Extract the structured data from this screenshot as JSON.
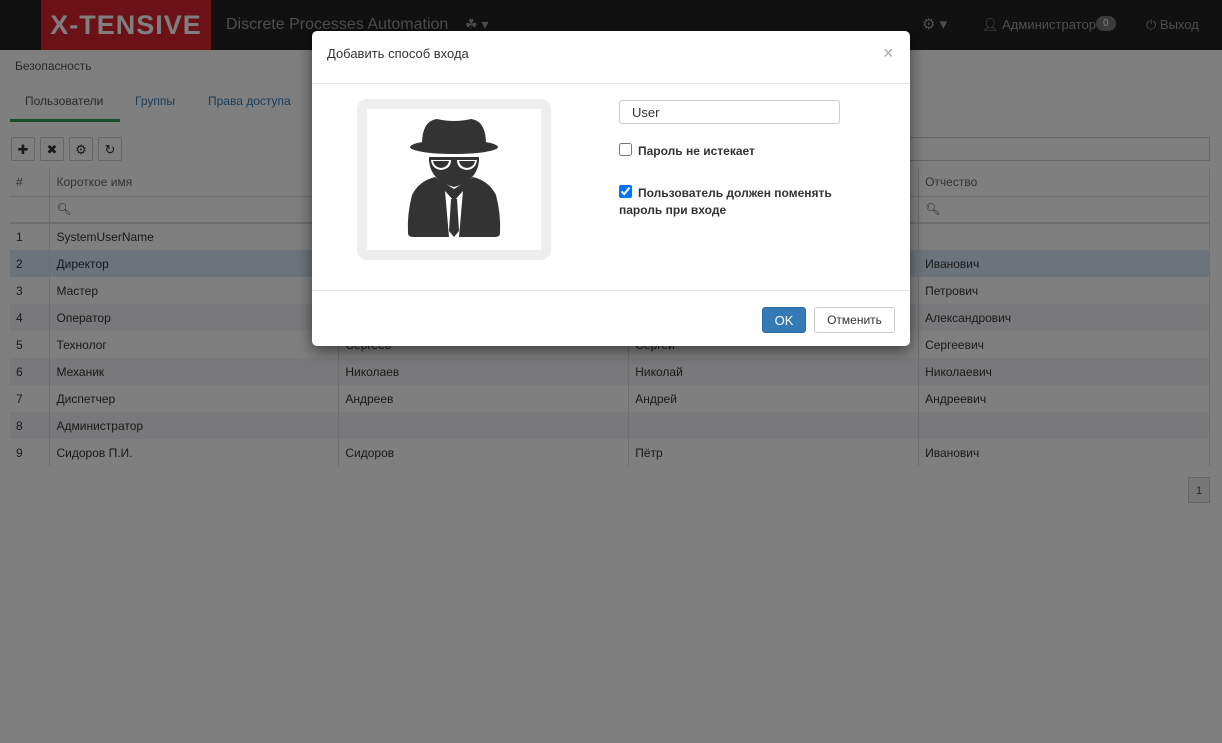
{
  "navbar": {
    "brand": "X-TENSIVE",
    "app_title": "Discrete Processes Automation",
    "apps_menu": "☘ ▾",
    "settings_menu": "⚙ ▾",
    "user_name": "Администратор",
    "notifications_count": "0",
    "logout_label": "Выход"
  },
  "breadcrumb": "Безопасность",
  "tabs": [
    {
      "label": "Пользователи",
      "active": true
    },
    {
      "label": "Группы",
      "active": false
    },
    {
      "label": "Права доступа",
      "active": false
    }
  ],
  "toolbar": {
    "add": "✚",
    "delete": "✖",
    "settings": "⚙",
    "refresh": "↻"
  },
  "table": {
    "columns": [
      "#",
      "Короткое имя",
      "",
      "",
      "Отчество"
    ],
    "rows": [
      [
        "1",
        "SystemUserName",
        "",
        "",
        ""
      ],
      [
        "2",
        "Директор",
        "",
        "",
        "Иванович"
      ],
      [
        "3",
        "Мастер",
        "",
        "",
        "Петрович"
      ],
      [
        "4",
        "Оператор",
        "",
        "",
        "Александрович"
      ],
      [
        "5",
        "Технолог",
        "Сергеев",
        "Сергей",
        "Сергеевич"
      ],
      [
        "6",
        "Механик",
        "Николаев",
        "Николай",
        "Николаевич"
      ],
      [
        "7",
        "Диспетчер",
        "Андреев",
        "Андрей",
        "Андреевич"
      ],
      [
        "8",
        "Администратор",
        "",
        "",
        ""
      ],
      [
        "9",
        "Сидоров П.И.",
        "Сидоров",
        "Пётр",
        "Иванович"
      ]
    ],
    "selected_row": 2,
    "page": "1"
  },
  "modal": {
    "title": "Добавить способ входа",
    "close": "×",
    "avatar_icon": "spy-icon",
    "login_value": "User",
    "password_never_expires_label": "Пароль не истекает",
    "password_never_expires_checked": false,
    "must_change_password_label_line1": "Пользователь должен поменять",
    "must_change_password_label_line2": "пароль при входе",
    "must_change_password_checked": true,
    "ok_label": "OK",
    "cancel_label": "Отменить"
  },
  "colors": {
    "brand": "#d9232d",
    "primary": "#337ab7",
    "active_tab": "#2e9e5b"
  }
}
